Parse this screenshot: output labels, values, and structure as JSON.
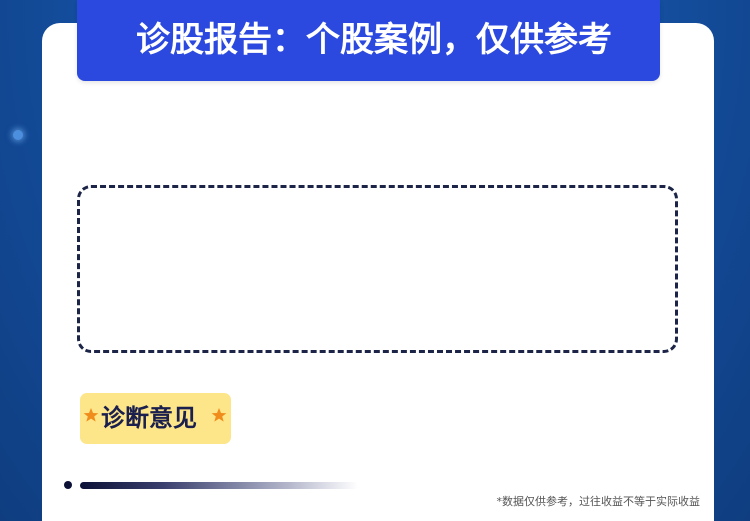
{
  "header": {
    "title": "诊股报告：个股案例，仅供参考"
  },
  "main": {
    "diagnosis": {
      "label": "诊断意见",
      "star_icon": "star-icon",
      "star_color": "#f08c1b"
    }
  },
  "footer": {
    "disclaimer": "*数据仅供参考，过往收益不等于实际收益"
  },
  "colors": {
    "banner": "#2b49de",
    "badge": "#fde58a",
    "dashed_border": "#1c2547"
  }
}
